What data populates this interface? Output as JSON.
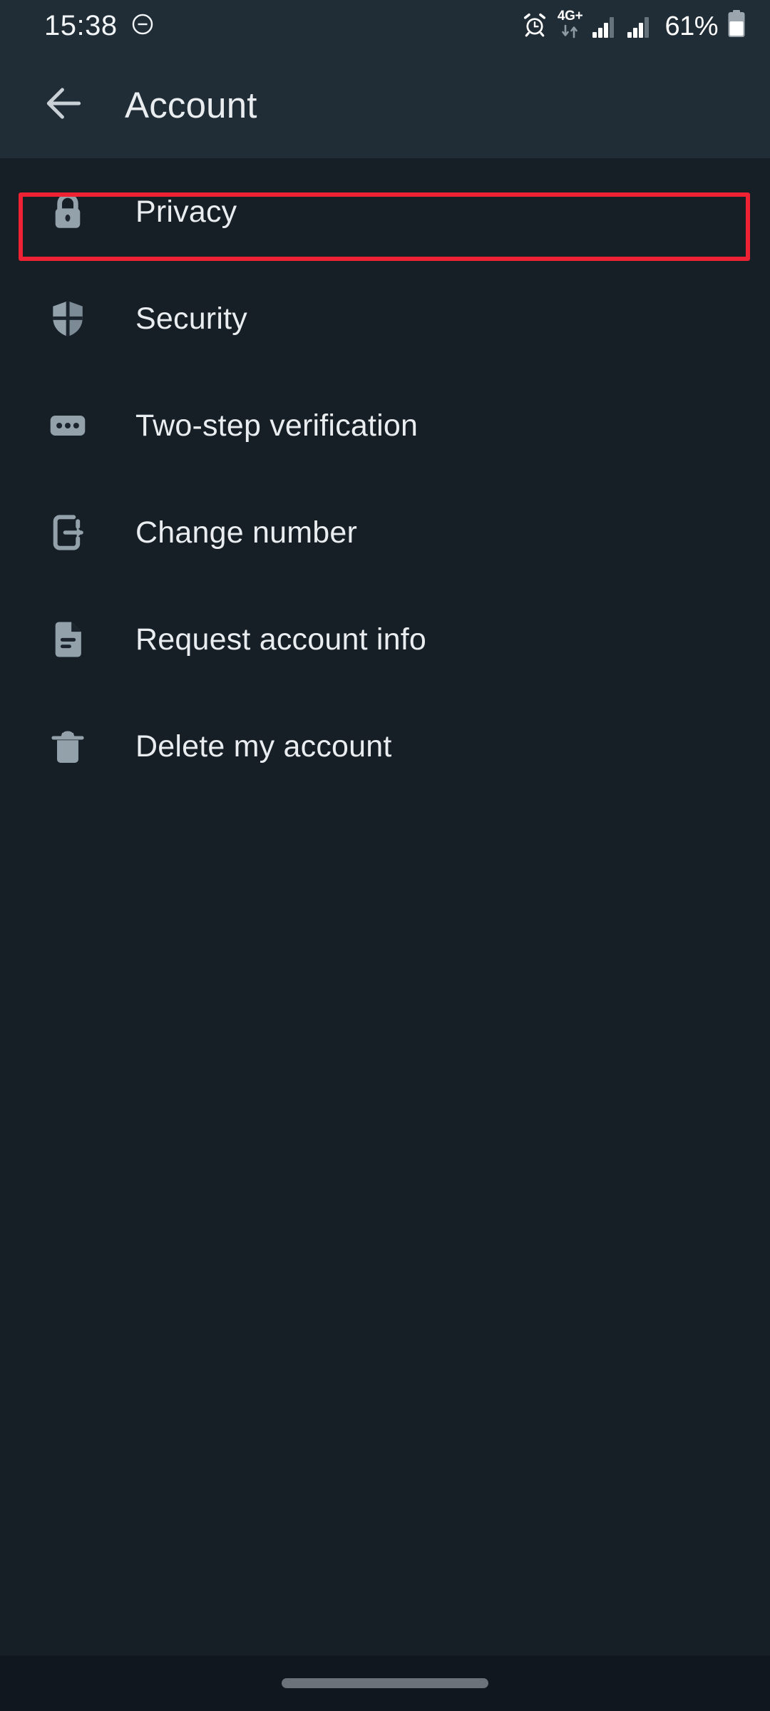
{
  "status_bar": {
    "time": "15:38",
    "dnd_icon": "do-not-disturb-icon",
    "alarm_icon": "alarm-clock-icon",
    "network_label": "4G+",
    "data_arrows_icon": "data-transfer-arrows-icon",
    "signal_icon_1": "signal-bars-icon",
    "signal_icon_2": "signal-bars-icon",
    "battery_percent": "61%",
    "battery_icon": "battery-icon",
    "battery_level": 61
  },
  "app_bar": {
    "back_icon": "back-arrow-icon",
    "title": "Account"
  },
  "list": {
    "items": [
      {
        "label": "Privacy",
        "icon": "lock-icon",
        "highlighted": true
      },
      {
        "label": "Security",
        "icon": "shield-icon",
        "highlighted": false
      },
      {
        "label": "Two-step verification",
        "icon": "password-dots-icon",
        "highlighted": false
      },
      {
        "label": "Change number",
        "icon": "phone-arrow-out-icon",
        "highlighted": false
      },
      {
        "label": "Request account info",
        "icon": "document-icon",
        "highlighted": false
      },
      {
        "label": "Delete my account",
        "icon": "trash-icon",
        "highlighted": false
      }
    ]
  },
  "nav_bar": {
    "gesture_pill": "home-gesture-pill"
  },
  "colors": {
    "screen_background": "#161E26",
    "bar_background": "#212D36",
    "text_primary": "#E9EDF0",
    "icon_gray": "#93A1AB",
    "highlight_red": "#EE2233",
    "nav_background": "#10171E"
  }
}
